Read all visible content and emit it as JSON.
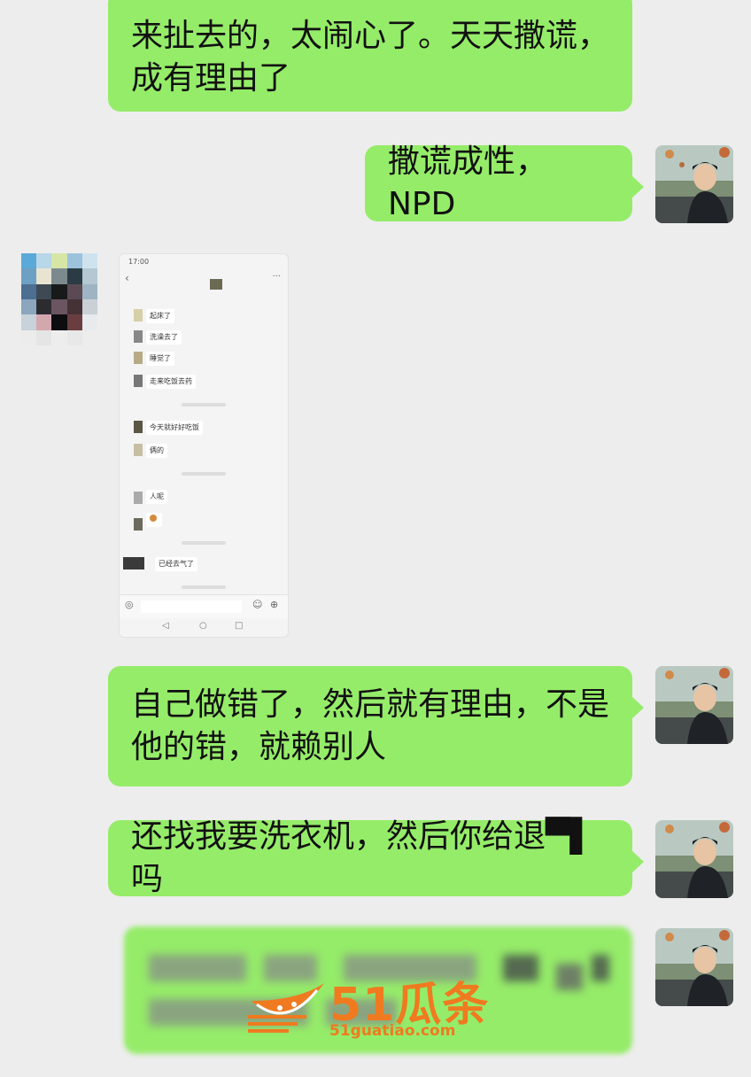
{
  "messages": [
    {
      "side": "right",
      "lines": [
        "来扯去的，太闹心了。天天撒谎，",
        "成有理由了"
      ]
    },
    {
      "side": "right",
      "lines": [
        "撒谎成性，NPD"
      ]
    },
    {
      "side": "left",
      "type": "image"
    },
    {
      "side": "right",
      "lines": [
        "自己做错了，然后就有理由，不是",
        "他的错，就赖别人"
      ]
    },
    {
      "side": "right",
      "lines": [
        "还找我要洗衣机，然后你给退▀▌吗"
      ]
    },
    {
      "side": "right",
      "type": "blurred"
    }
  ],
  "embedded_screenshot": {
    "status_time": "17:00",
    "back_icon": "‹",
    "more_icon": "···",
    "chat": [
      "起床了",
      "洗澡去了",
      "睡觉了",
      "走来吃饭去药",
      "今天就好好吃饭",
      "俩的",
      "人呢",
      "",
      "已经去气了"
    ],
    "input_icons": [
      "voice-icon",
      "emoji-icon",
      "plus-icon"
    ],
    "nav_icons": [
      "◁",
      "○",
      "□"
    ]
  },
  "watermark": {
    "brand": "51瓜条",
    "url": "51guatiao.com"
  },
  "colors": {
    "bubble": "#95ec69",
    "background": "#ededed",
    "watermark": "#f07a1f"
  }
}
